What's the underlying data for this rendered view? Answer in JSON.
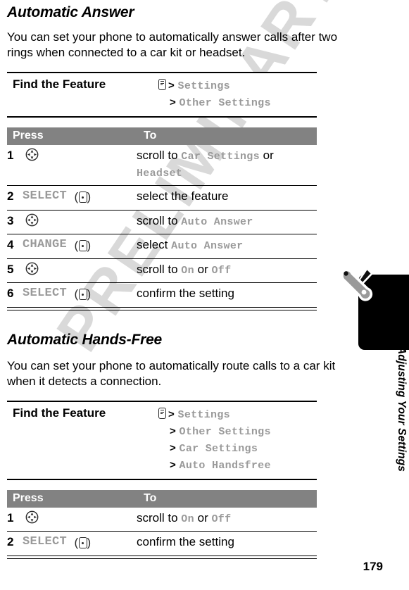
{
  "watermark": {
    "text": "PRELIMINARY"
  },
  "page": {
    "number": "179",
    "side_title": "Adjusting Your Settings",
    "tab_icon": "wrench-screwdriver-icon"
  },
  "sections": [
    {
      "title": "Automatic Answer",
      "body": "You can set your phone to automatically answer calls after two rings when connected to a car kit or headset.",
      "find_the_feature": {
        "label": "Find the Feature",
        "menu_icon": "menu-key-icon",
        "path": [
          "Settings",
          "Other Settings"
        ]
      },
      "table": {
        "headers": {
          "press": "Press",
          "to": "To"
        },
        "rows": [
          {
            "num": "1",
            "key_icon": "nav-key-icon",
            "key_label": "",
            "action_prefix": "scroll to ",
            "action_mono": "Car Settings",
            "action_mid": " or ",
            "action_mono2": "Headset",
            "action_suffix": ""
          },
          {
            "num": "2",
            "key_icon": "soft-key-icon",
            "key_label": "SELECT",
            "action_prefix": "select the feature",
            "action_mono": "",
            "action_mid": "",
            "action_mono2": "",
            "action_suffix": ""
          },
          {
            "num": "3",
            "key_icon": "nav-key-icon",
            "key_label": "",
            "action_prefix": "scroll to ",
            "action_mono": "Auto Answer",
            "action_mid": "",
            "action_mono2": "",
            "action_suffix": ""
          },
          {
            "num": "4",
            "key_icon": "soft-key-icon",
            "key_label": "CHANGE",
            "action_prefix": "select ",
            "action_mono": "Auto Answer",
            "action_mid": "",
            "action_mono2": "",
            "action_suffix": ""
          },
          {
            "num": "5",
            "key_icon": "nav-key-icon",
            "key_label": "",
            "action_prefix": "scroll to ",
            "action_mono": "On",
            "action_mid": " or ",
            "action_mono2": "Off",
            "action_suffix": ""
          },
          {
            "num": "6",
            "key_icon": "soft-key-icon",
            "key_label": "SELECT",
            "action_prefix": "confirm the setting",
            "action_mono": "",
            "action_mid": "",
            "action_mono2": "",
            "action_suffix": ""
          }
        ]
      }
    },
    {
      "title": "Automatic Hands-Free",
      "body": "You can set your phone to automatically route calls to a car kit when it detects a connection.",
      "find_the_feature": {
        "label": "Find the Feature",
        "menu_icon": "menu-key-icon",
        "path": [
          "Settings",
          "Other Settings",
          "Car Settings",
          "Auto Handsfree"
        ]
      },
      "table": {
        "headers": {
          "press": "Press",
          "to": "To"
        },
        "rows": [
          {
            "num": "1",
            "key_icon": "nav-key-icon",
            "key_label": "",
            "action_prefix": "scroll to ",
            "action_mono": "On",
            "action_mid": " or ",
            "action_mono2": "Off",
            "action_suffix": ""
          },
          {
            "num": "2",
            "key_icon": "soft-key-icon",
            "key_label": "SELECT",
            "action_prefix": "confirm the setting",
            "action_mono": "",
            "action_mid": "",
            "action_mono2": "",
            "action_suffix": ""
          }
        ]
      }
    }
  ],
  "colors": {
    "header_bar": "#828282",
    "mono_gray": "#9a9a9a",
    "watermark": "#d9d9d9",
    "tab_black": "#000000"
  }
}
